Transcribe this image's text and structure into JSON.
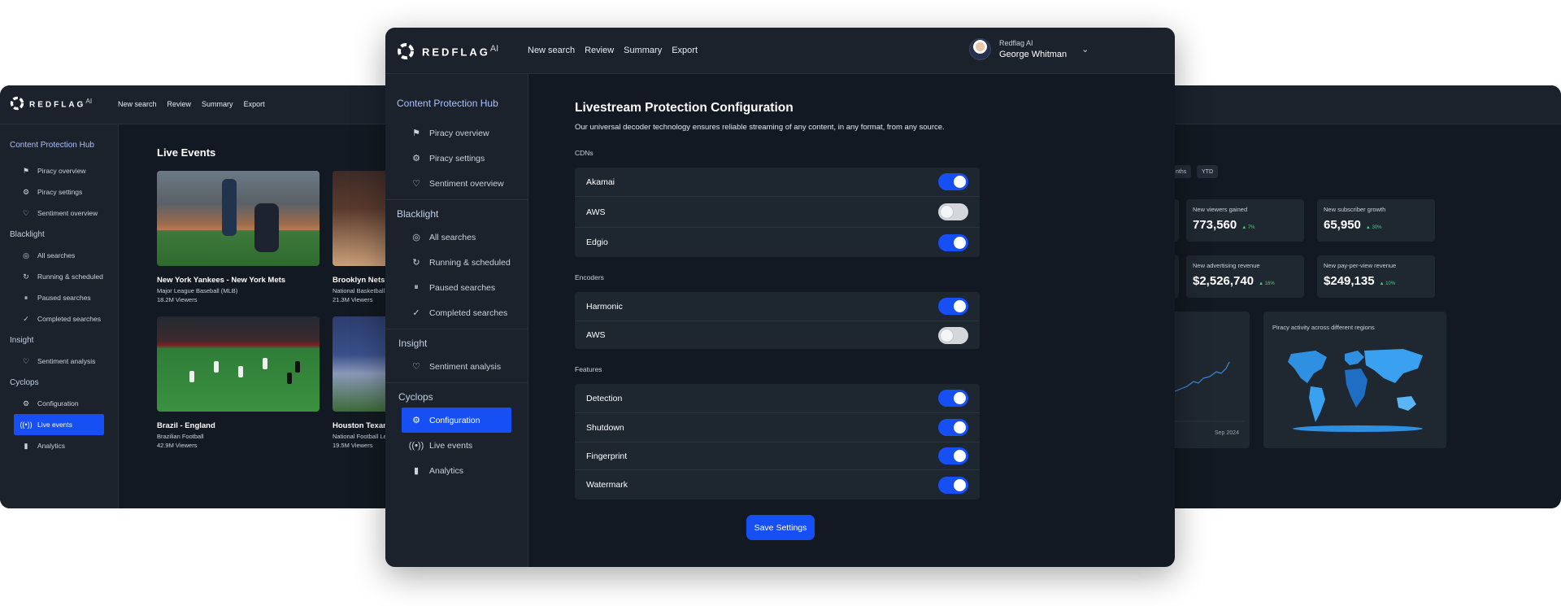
{
  "brand": {
    "name": "REDFLAG",
    "suffix": "AI"
  },
  "nav": [
    "New search",
    "Review",
    "Summary",
    "Export"
  ],
  "user": {
    "org": "Redflag AI",
    "name": "George Whitman"
  },
  "sidebar": {
    "hub_title": "Content Protection Hub",
    "hub_items": [
      {
        "label": "Piracy overview",
        "icon": "flag-icon"
      },
      {
        "label": "Piracy settings",
        "icon": "settings-icon"
      },
      {
        "label": "Sentiment overview",
        "icon": "heart-icon"
      }
    ],
    "blacklight_title": "Blacklight",
    "blacklight_items": [
      {
        "label": "All searches",
        "icon": "search-circle-icon"
      },
      {
        "label": "Running & scheduled",
        "icon": "running-icon"
      },
      {
        "label": "Paused searches",
        "icon": "pause-icon"
      },
      {
        "label": "Completed searches",
        "icon": "check-icon"
      }
    ],
    "insight_title": "Insight",
    "insight_items": [
      {
        "label": "Sentiment analysis",
        "icon": "heart-icon"
      }
    ],
    "cyclops_title": "Cyclops",
    "cyclops_items": [
      {
        "label": "Configuration",
        "icon": "settings-icon"
      },
      {
        "label": "Live events",
        "icon": "broadcast-icon"
      },
      {
        "label": "Analytics",
        "icon": "bar-chart-icon"
      }
    ]
  },
  "live": {
    "title": "Live Events",
    "cards": [
      {
        "title": "New York Yankees - New York Mets",
        "sub": "Major League Baseball (MLB)",
        "views": "18.2M Viewers"
      },
      {
        "title": "Brooklyn Nets",
        "sub": "National Basketball",
        "views": "21.3M Viewers"
      },
      {
        "title": "Brazil - England",
        "sub": "Brazilian Football",
        "views": "42.9M Viewers"
      },
      {
        "title": "Houston Texan",
        "sub": "National Football Le",
        "views": "19.5M Viewers"
      }
    ]
  },
  "stats": {
    "pills": [
      "nths",
      "YTD"
    ],
    "cards": [
      {
        "label": "New viewers gained",
        "value": "773,560",
        "delta": "▲ 7%"
      },
      {
        "label": "New subscriber growth",
        "value": "65,950",
        "delta": "▲ 30%"
      },
      {
        "label": "New advertising revenue",
        "value": "$2,526,740",
        "delta": "▲ 16%"
      },
      {
        "label": "New pay-per-view revenue",
        "value": "$249,135",
        "delta": "▲ 10%"
      }
    ],
    "chart_axis_label": "Sep 2024",
    "map_title": "Piracy activity across different regions"
  },
  "config": {
    "title": "Livestream Protection Configuration",
    "subtitle": "Our universal decoder technology ensures reliable streaming of any content, in any format, from any source.",
    "cdns_label": "CDNs",
    "cdns": [
      {
        "label": "Akamai",
        "on": true
      },
      {
        "label": "AWS",
        "on": false
      },
      {
        "label": "Edgio",
        "on": true
      }
    ],
    "encoders_label": "Encoders",
    "encoders": [
      {
        "label": "Harmonic",
        "on": true
      },
      {
        "label": "AWS",
        "on": false
      }
    ],
    "features_label": "Features",
    "features": [
      {
        "label": "Detection",
        "on": true
      },
      {
        "label": "Shutdown",
        "on": true
      },
      {
        "label": "Fingerprint",
        "on": true
      },
      {
        "label": "Watermark",
        "on": true
      }
    ],
    "save_label": "Save Settings"
  },
  "colors": {
    "accent": "#1650f5",
    "bg": "#131922",
    "panel": "#1b222c",
    "positive": "#4ad07a"
  }
}
